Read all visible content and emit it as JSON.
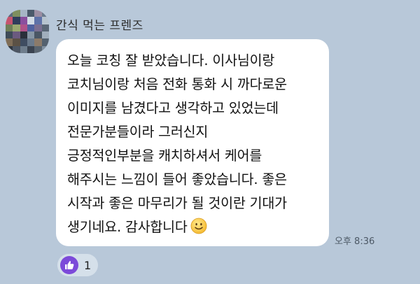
{
  "chat": {
    "sender_name": "간식 먹는 프렌즈",
    "message_lines": [
      "오늘 코칭 잘 받았습니다. 이사님이랑",
      "코치님이랑 처음 전화 통화 시 까다로운",
      "이미지를 남겼다고 생각하고 있었는데",
      "전문가분들이라 그러신지",
      "긍정적인부분을 캐치하셔서 케어를",
      "해주시는 느낌이 들어 좋았습니다. 좋은",
      "시작과 좋은 마무리가 될 것이란 기대가",
      "생기네요. 감사합니다"
    ],
    "emoji_icon": "smiling-face-emoji-icon",
    "timestamp": "오후 8:36",
    "reaction": {
      "icon": "thumbs-up-icon",
      "count": "1"
    }
  },
  "colors": {
    "background": "#b8c8d9",
    "bubble": "#ffffff",
    "reaction_accent": "#7c4ad9"
  }
}
